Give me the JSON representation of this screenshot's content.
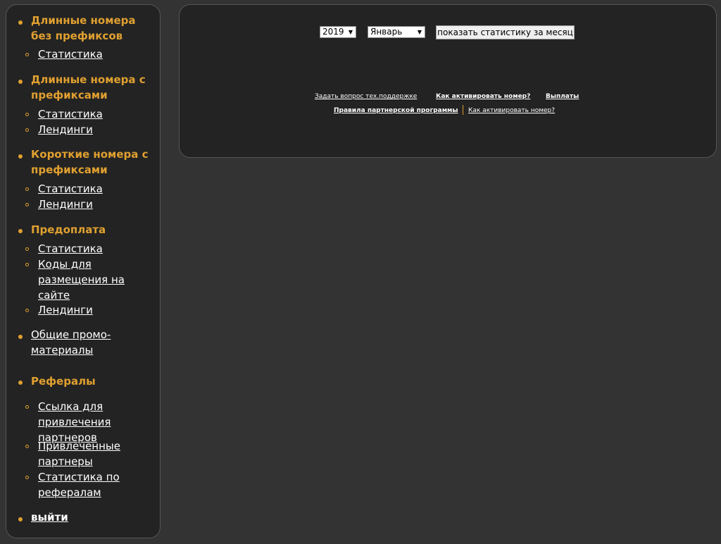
{
  "sidebar": {
    "sections": [
      {
        "title_lines": [
          "Длинные номера",
          "без префиксов"
        ],
        "items": [
          "Статистика"
        ]
      },
      {
        "title_lines": [
          "Длинные номера с",
          "префиксами"
        ],
        "items": [
          "Статистика",
          "Лендинги"
        ]
      },
      {
        "title_lines": [
          "Короткие номера с",
          "префиксами"
        ],
        "items": [
          "Статистика",
          "Лендинги"
        ]
      },
      {
        "title_lines": [
          "Предоплата"
        ],
        "items": [
          "Статистика",
          [
            "Коды для",
            "размещения на",
            "сайте"
          ],
          "Лендинги"
        ]
      },
      {
        "title_lines": [
          "Общие промо-",
          "материалы"
        ],
        "items": []
      },
      {
        "title_lines": [
          "Рефералы"
        ],
        "items": [
          [
            "Ссылка для",
            "привлечения",
            "партнеров"
          ],
          [
            "Привлеченные",
            "партнеры"
          ],
          [
            "Статистика по",
            "рефералам"
          ]
        ]
      }
    ],
    "logout_label": "выйти"
  },
  "filter": {
    "year": "2019",
    "month": "Январь",
    "show_button": "показать статистику за месяц"
  },
  "footer_links": {
    "support": "Задать вопрос тех.поддержке",
    "activate": "Как активировать номер?",
    "payouts": "Выплаты",
    "rules": "Правила партнерской программы",
    "activate2": "Как активировать номер?"
  },
  "colors": {
    "accent": "#e0a030",
    "panel": "#232323",
    "page": "#333333"
  }
}
